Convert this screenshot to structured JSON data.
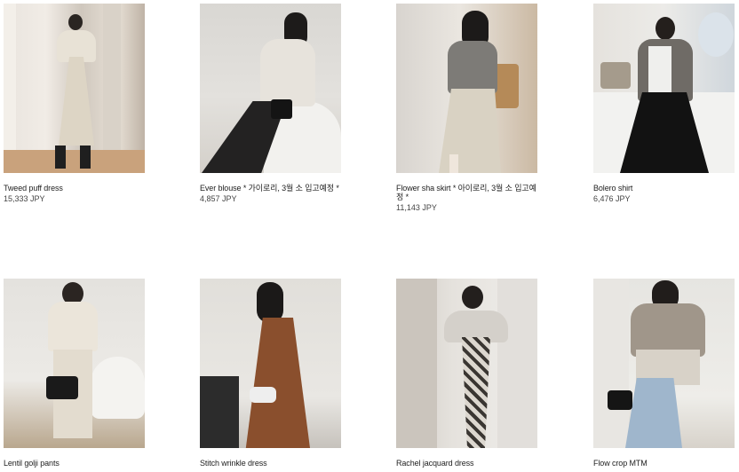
{
  "products": [
    {
      "name": "Tweed puff dress",
      "price": "15,333 JPY"
    },
    {
      "name": "Ever blouse * 가이로리, 3월 소 입고예정 *",
      "price": "4,857 JPY"
    },
    {
      "name": "Flower sha skirt * 아이로리, 3월 소 입고예정 *",
      "price": "11,143 JPY"
    },
    {
      "name": "Bolero shirt",
      "price": "6,476 JPY"
    },
    {
      "name": "Lentil golji pants",
      "price": ""
    },
    {
      "name": "Stitch wrinkle dress",
      "price": ""
    },
    {
      "name": "Rachel jacquard dress",
      "price": ""
    },
    {
      "name": "Flow crop MTM",
      "price": ""
    }
  ]
}
